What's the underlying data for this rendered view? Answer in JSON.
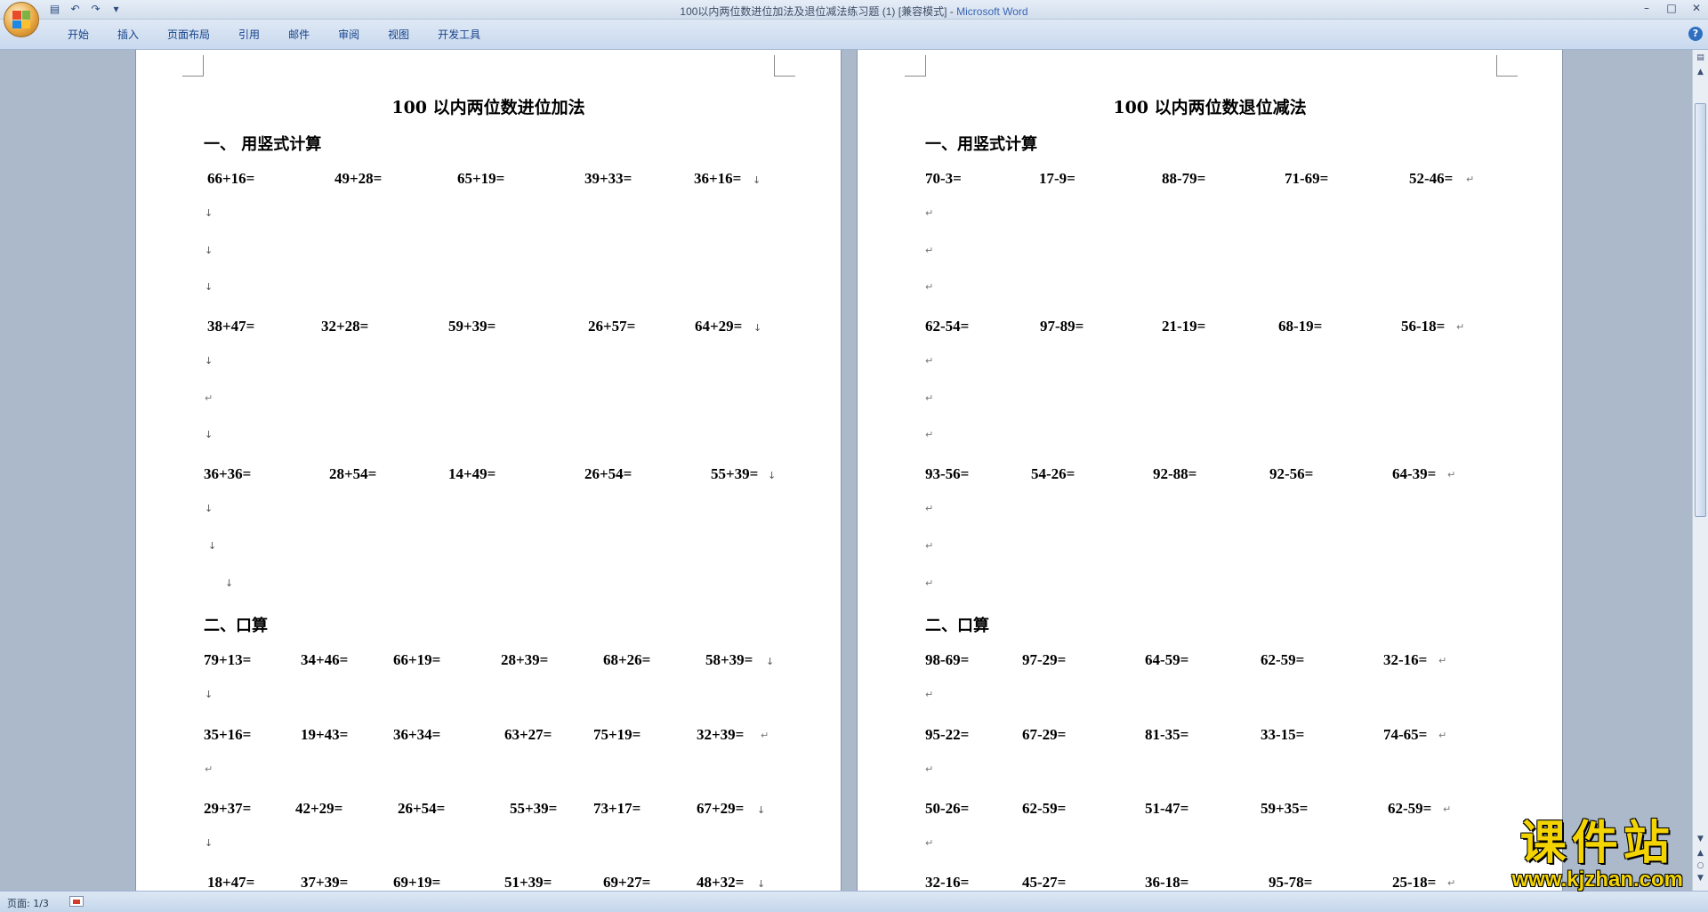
{
  "window": {
    "title_doc": "100以内两位数进位加法及退位减法练习题 (1) [兼容模式] - ",
    "title_app": "Microsoft Word"
  },
  "quick_access": {
    "icons": [
      "save-icon",
      "undo-icon",
      "redo-icon",
      "customize-icon"
    ]
  },
  "ribbon": {
    "tabs": [
      "开始",
      "插入",
      "页面布局",
      "引用",
      "邮件",
      "审阅",
      "视图",
      "开发工具"
    ]
  },
  "status_bar": {
    "page": "页面: 1/3"
  },
  "watermark": {
    "text": "课件站",
    "url": "www.kjzhan.com"
  },
  "left_page": {
    "title": "100 以内两位数进位加法",
    "section1": "一、  用竖式计算",
    "vertical_rows": [
      [
        "66+16=",
        "49+28=",
        "65+19=",
        "39+33=",
        "36+16="
      ],
      [
        "38+47=",
        "32+28=",
        "59+39=",
        "26+57=",
        "64+29="
      ],
      [
        "36+36=",
        "28+54=",
        "14+49=",
        "26+54=",
        "55+39="
      ]
    ],
    "section2": "二、口算",
    "oral_rows": [
      [
        "79+13=",
        "34+46=",
        "66+19=",
        "28+39=",
        "68+26=",
        "58+39="
      ],
      [
        "35+16=",
        "19+43=",
        "36+34=",
        "63+27=",
        "75+19=",
        "32+39="
      ],
      [
        "29+37=",
        "42+29=",
        "26+54=",
        "55+39=",
        "73+17=",
        "67+29="
      ],
      [
        "18+47=",
        "37+39=",
        "69+19=",
        "51+39=",
        "69+27=",
        "48+32="
      ]
    ]
  },
  "right_page": {
    "title": "100 以内两位数退位减法",
    "section1": "一、用竖式计算",
    "vertical_rows": [
      [
        "70-3=",
        "17-9=",
        "88-79=",
        "71-69=",
        "52-46="
      ],
      [
        "62-54=",
        "97-89=",
        "21-19=",
        "68-19=",
        "56-18="
      ],
      [
        "93-56=",
        "54-26=",
        "92-88=",
        "92-56=",
        "64-39="
      ]
    ],
    "section2": "二、口算",
    "oral_rows": [
      [
        "98-69=",
        "97-29=",
        "64-59=",
        "62-59=",
        "32-16="
      ],
      [
        "95-22=",
        "67-29=",
        "81-35=",
        "33-15=",
        "74-65="
      ],
      [
        "50-26=",
        "62-59=",
        "51-47=",
        "59+35=",
        "62-59="
      ],
      [
        "32-16=",
        "45-27=",
        "36-18=",
        "95-78=",
        "25-18="
      ]
    ]
  }
}
